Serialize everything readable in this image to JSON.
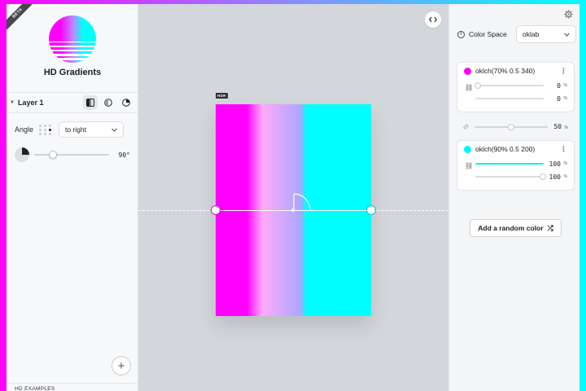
{
  "app": {
    "title": "HD Gradients",
    "badge": "BETA"
  },
  "layer": {
    "name": "Layer 1",
    "angle_label": "Angle",
    "direction_value": "to right",
    "angle_value": "90°",
    "angle_fraction": 0.25
  },
  "left_footer": {
    "examples_label": "HD EXAMPLES"
  },
  "canvas": {
    "hdr_badge": "HDR"
  },
  "color_space": {
    "label": "Color Space",
    "value": "oklab"
  },
  "stops": [
    {
      "label": "oklch(70% 0.5 340)",
      "color": "#ff00ff",
      "values": [
        "0",
        "0"
      ],
      "unit": "%"
    },
    {
      "label": "oklch(90% 0.5 200)",
      "color": "#00f5f5",
      "values": [
        "100",
        "100"
      ],
      "unit": "%"
    }
  ],
  "midpoint": {
    "value": "50",
    "unit": "%"
  },
  "actions": {
    "add_random": "Add a random color"
  },
  "colors": {
    "magenta": "#ff00ff",
    "cyan": "#00ffff",
    "handle_border": "#d010d0"
  }
}
